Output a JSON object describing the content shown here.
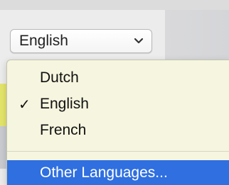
{
  "language_popup": {
    "selected_value": "English",
    "chevron_icon": "chevron-down-icon"
  },
  "menu": {
    "items": [
      {
        "label": "Dutch",
        "checked": false
      },
      {
        "label": "English",
        "checked": true,
        "check_mark": "✓"
      },
      {
        "label": "French",
        "checked": false
      }
    ],
    "other": {
      "label": "Other Languages...",
      "highlighted": true
    }
  },
  "colors": {
    "highlight": "#2f6fe0",
    "menu_background": "#f6f5df"
  }
}
